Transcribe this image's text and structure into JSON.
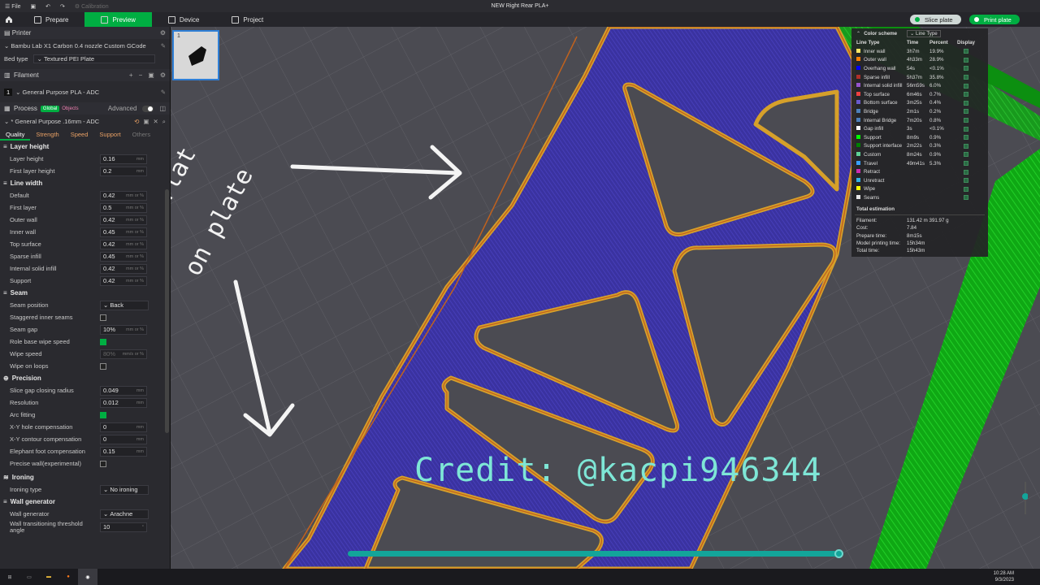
{
  "titlebar": {
    "file_menu": "File",
    "calibration": "Calibration",
    "title": "NEW Right Rear PLA+"
  },
  "tabs": {
    "prepare": "Prepare",
    "preview": "Preview",
    "device": "Device",
    "project": "Project"
  },
  "actions": {
    "slice": "Slice plate",
    "print": "Print plate"
  },
  "printer": {
    "section": "Printer",
    "name": "Bambu Lab X1 Carbon 0.4 nozzle Custom GCode",
    "bed_label": "Bed type",
    "bed_value": "Textured PEI Plate"
  },
  "filament": {
    "section": "Filament",
    "index": "1",
    "name": "General Purpose PLA - ADC"
  },
  "process": {
    "section": "Process",
    "global_badge": "Global",
    "objects_badge": "Objects",
    "advanced_label": "Advanced",
    "preset": "* General Purpose .16mm - ADC",
    "subtabs": [
      "Quality",
      "Strength",
      "Speed",
      "Support",
      "Others"
    ]
  },
  "groups": {
    "layer_height": "Layer height",
    "line_width": "Line width",
    "seam": "Seam",
    "precision": "Precision",
    "ironing": "Ironing",
    "wall_generator": "Wall generator"
  },
  "params": {
    "layer_height": {
      "label": "Layer height",
      "value": "0.16",
      "unit": "mm"
    },
    "first_layer_height": {
      "label": "First layer height",
      "value": "0.2",
      "unit": "mm"
    },
    "lw_default": {
      "label": "Default",
      "value": "0.42",
      "unit": "mm or %"
    },
    "lw_first_layer": {
      "label": "First layer",
      "value": "0.5",
      "unit": "mm or %"
    },
    "lw_outer_wall": {
      "label": "Outer wall",
      "value": "0.42",
      "unit": "mm or %"
    },
    "lw_inner_wall": {
      "label": "Inner wall",
      "value": "0.45",
      "unit": "mm or %"
    },
    "lw_top_surface": {
      "label": "Top surface",
      "value": "0.42",
      "unit": "mm or %"
    },
    "lw_sparse_infill": {
      "label": "Sparse infill",
      "value": "0.45",
      "unit": "mm or %"
    },
    "lw_internal_solid": {
      "label": "Internal solid infill",
      "value": "0.42",
      "unit": "mm or %"
    },
    "lw_support": {
      "label": "Support",
      "value": "0.42",
      "unit": "mm or %"
    },
    "seam_position": {
      "label": "Seam position",
      "value": "Back"
    },
    "staggered_inner_seams": {
      "label": "Staggered inner seams"
    },
    "seam_gap": {
      "label": "Seam gap",
      "value": "10%",
      "unit": "mm or %"
    },
    "role_base_wipe_speed": {
      "label": "Role base wipe speed"
    },
    "wipe_speed": {
      "label": "Wipe speed",
      "value": "80%",
      "unit": "mm/s or %"
    },
    "wipe_on_loops": {
      "label": "Wipe on loops"
    },
    "slice_gap_closing_radius": {
      "label": "Slice gap closing radius",
      "value": "0.049",
      "unit": "mm"
    },
    "resolution": {
      "label": "Resolution",
      "value": "0.012",
      "unit": "mm"
    },
    "arc_fitting": {
      "label": "Arc fitting"
    },
    "xy_hole_comp": {
      "label": "X-Y hole compensation",
      "value": "0",
      "unit": "mm"
    },
    "xy_contour_comp": {
      "label": "X-Y contour compensation",
      "value": "0",
      "unit": "mm"
    },
    "elephant_foot": {
      "label": "Elephant foot compensation",
      "value": "0.15",
      "unit": "mm"
    },
    "precise_wall": {
      "label": "Precise wall(experimental)"
    },
    "ironing_type": {
      "label": "Ironing type",
      "value": "No ironing"
    },
    "wall_generator": {
      "label": "Wall generator",
      "value": "Arachne"
    },
    "wall_transition": {
      "label": "Wall transitioning threshold angle",
      "value": "10",
      "unit": "°"
    }
  },
  "legend": {
    "title": "Color scheme",
    "scheme": "Line Type",
    "headers": [
      "Line Type",
      "Time",
      "Percent",
      "Display"
    ],
    "rows": [
      {
        "name": "Inner wall",
        "time": "3h7m",
        "pct": "19.9%",
        "color": "#ffe566"
      },
      {
        "name": "Outer wall",
        "time": "4h33m",
        "pct": "28.9%",
        "color": "#ff7f00"
      },
      {
        "name": "Overhang wall",
        "time": "54s",
        "pct": "<0.1%",
        "color": "#0000ff"
      },
      {
        "name": "Sparse infill",
        "time": "5h37m",
        "pct": "35.8%",
        "color": "#b03029"
      },
      {
        "name": "Internal solid infill",
        "time": "56m59s",
        "pct": "6.0%",
        "color": "#9654cc"
      },
      {
        "name": "Top surface",
        "time": "6m46s",
        "pct": "0.7%",
        "color": "#f04040"
      },
      {
        "name": "Bottom surface",
        "time": "3m25s",
        "pct": "0.4%",
        "color": "#6a5acd"
      },
      {
        "name": "Bridge",
        "time": "2m1s",
        "pct": "0.2%",
        "color": "#4d80ba"
      },
      {
        "name": "Internal Bridge",
        "time": "7m20s",
        "pct": "0.8%",
        "color": "#4d80ba"
      },
      {
        "name": "Gap infill",
        "time": "3s",
        "pct": "<0.1%",
        "color": "#ffffff"
      },
      {
        "name": "Support",
        "time": "8m9s",
        "pct": "0.9%",
        "color": "#00ff00"
      },
      {
        "name": "Support interface",
        "time": "2m22s",
        "pct": "0.3%",
        "color": "#008000"
      },
      {
        "name": "Custom",
        "time": "8m24s",
        "pct": "0.9%",
        "color": "#5ed194"
      },
      {
        "name": "Travel",
        "time": "49m41s",
        "pct": "5.3%",
        "color": "#38a0ff"
      },
      {
        "name": "Retract",
        "time": "",
        "pct": "",
        "color": "#cc2bb0"
      },
      {
        "name": "Unretract",
        "time": "",
        "pct": "",
        "color": "#33b3e6"
      },
      {
        "name": "Wipe",
        "time": "",
        "pct": "",
        "color": "#ffff00"
      },
      {
        "name": "Seams",
        "time": "",
        "pct": "",
        "color": "#e6e6e6"
      }
    ],
    "total_title": "Total estimation",
    "estimation": [
      {
        "k": "Filament:",
        "v": "131.42 m    391.97 g"
      },
      {
        "k": "Cost:",
        "v": "7.84"
      },
      {
        "k": "Prepare time:",
        "v": "8m15s"
      },
      {
        "k": "Model printing time:",
        "v": "15h34m"
      },
      {
        "k": "Total time:",
        "v": "15h43m"
      }
    ]
  },
  "plate_thumbnail": {
    "number": "1"
  },
  "annotations": {
    "line1": "Now flat",
    "line2": "on plate",
    "credit": "Credit: @kacpi946344"
  },
  "taskbar": {
    "time": "10:28 AM",
    "date": "9/3/2023"
  }
}
